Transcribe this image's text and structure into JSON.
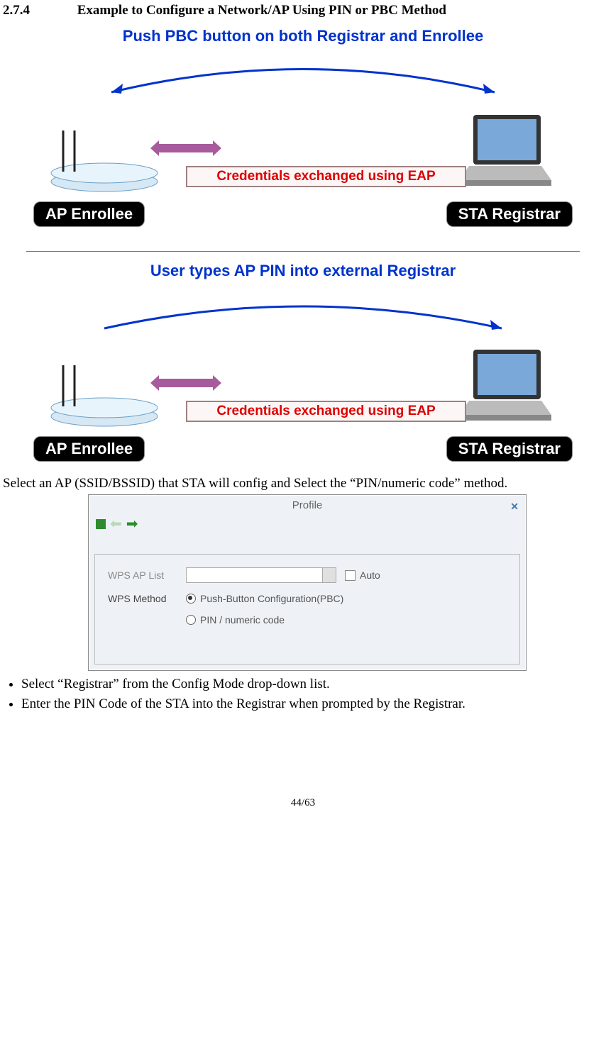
{
  "section": {
    "number": "2.7.4",
    "title": "Example to Configure a Network/AP Using PIN or PBC Method"
  },
  "diag1": {
    "title": "Push PBC button on both Registrar and Enrollee",
    "cred": "Credentials exchanged using EAP",
    "left": "AP Enrollee",
    "right": "STA Registrar"
  },
  "diag2": {
    "title": "User types AP PIN into external Registrar",
    "cred": "Credentials exchanged using EAP",
    "left": "AP Enrollee",
    "right": "STA Registrar"
  },
  "para1": "Select an AP (SSID/BSSID) that STA will config and Select the “PIN/numeric code” method.",
  "dialog": {
    "title": "Profile",
    "wps_ap_label": "WPS AP List",
    "auto": "Auto",
    "method_label": "WPS Method",
    "opt_pbc": "Push-Button Configuration(PBC)",
    "opt_pin": "PIN / numeric code"
  },
  "bullets": [
    "Select “Registrar” from the Config Mode drop-down list.",
    "Enter the PIN Code of the STA into the Registrar when prompted by the Registrar."
  ],
  "page": "44/63"
}
